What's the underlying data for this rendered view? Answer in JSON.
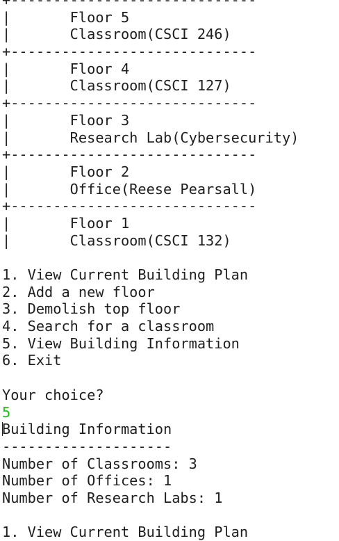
{
  "terminal": {
    "lines": [
      {
        "text": "+-----------------------------",
        "kind": "separator"
      },
      {
        "text": "|       Floor 5",
        "kind": "floor"
      },
      {
        "text": "|       Classroom(CSCI 246)",
        "kind": "room"
      },
      {
        "text": "+-----------------------------",
        "kind": "separator"
      },
      {
        "text": "|       Floor 4",
        "kind": "floor"
      },
      {
        "text": "|       Classroom(CSCI 127)",
        "kind": "room"
      },
      {
        "text": "+-----------------------------",
        "kind": "separator"
      },
      {
        "text": "|       Floor 3",
        "kind": "floor"
      },
      {
        "text": "|       Research Lab(Cybersecurity)",
        "kind": "room"
      },
      {
        "text": "+-----------------------------",
        "kind": "separator"
      },
      {
        "text": "|       Floor 2",
        "kind": "floor"
      },
      {
        "text": "|       Office(Reese Pearsall)",
        "kind": "room"
      },
      {
        "text": "+-----------------------------",
        "kind": "separator"
      },
      {
        "text": "|       Floor 1",
        "kind": "floor"
      },
      {
        "text": "|       Classroom(CSCI 132)",
        "kind": "room"
      },
      {
        "text": "",
        "kind": "blank"
      },
      {
        "text": "1. View Current Building Plan",
        "kind": "menu"
      },
      {
        "text": "2. Add a new floor",
        "kind": "menu"
      },
      {
        "text": "3. Demolish top floor",
        "kind": "menu"
      },
      {
        "text": "4. Search for a classroom",
        "kind": "menu"
      },
      {
        "text": "5. View Building Information",
        "kind": "menu"
      },
      {
        "text": "6. Exit",
        "kind": "menu"
      },
      {
        "text": "",
        "kind": "blank"
      },
      {
        "text": "Your choice?",
        "kind": "prompt"
      },
      {
        "text": "5",
        "kind": "input"
      },
      {
        "text": "Building Information",
        "kind": "heading",
        "caret": true
      },
      {
        "text": "--------------------",
        "kind": "rule"
      },
      {
        "text": "Number of Classrooms: 3",
        "kind": "info"
      },
      {
        "text": "Number of Offices: 1",
        "kind": "info"
      },
      {
        "text": "Number of Research Labs: 1",
        "kind": "info"
      },
      {
        "text": "",
        "kind": "blank"
      },
      {
        "text": "1. View Current Building Plan",
        "kind": "menu"
      }
    ],
    "colors": {
      "background": "#ffffff",
      "text": "#1e1e1e",
      "user_input": "#16c60c"
    }
  }
}
